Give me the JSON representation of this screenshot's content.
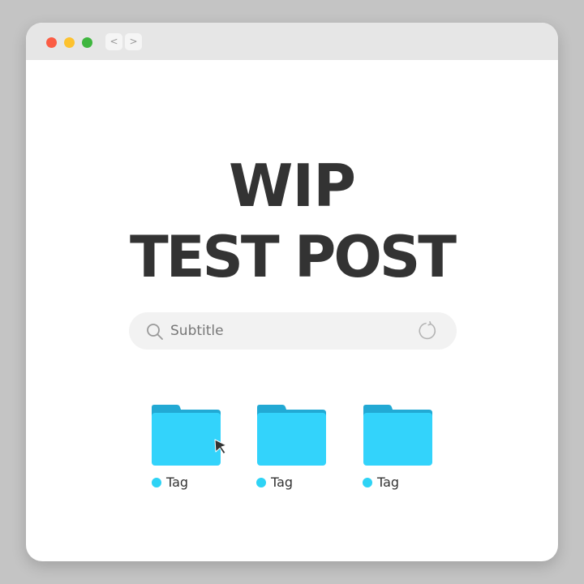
{
  "window": {
    "traffic_lights": [
      "close",
      "minimize",
      "maximize"
    ],
    "nav": {
      "back_label": "<",
      "forward_label": ">"
    }
  },
  "main": {
    "title_line_1": "WIP",
    "title_line_2": "TEST POST",
    "search": {
      "value": "Subtitle",
      "icon": "search-icon",
      "action_icon": "refresh-icon"
    },
    "folders": [
      {
        "tag": "Tag",
        "icon": "folder-icon"
      },
      {
        "tag": "Tag",
        "icon": "folder-icon"
      },
      {
        "tag": "Tag",
        "icon": "folder-icon"
      }
    ]
  },
  "colors": {
    "background": "#c4c4c4",
    "titlebar": "#e6e6e6",
    "close": "#fb5c44",
    "minimize": "#fdc22e",
    "maximize": "#3eb63e",
    "folder_front": "#33d3fb",
    "folder_back": "#22a9d4",
    "tag_dot": "#2ed3f5",
    "title_text": "#333333"
  }
}
